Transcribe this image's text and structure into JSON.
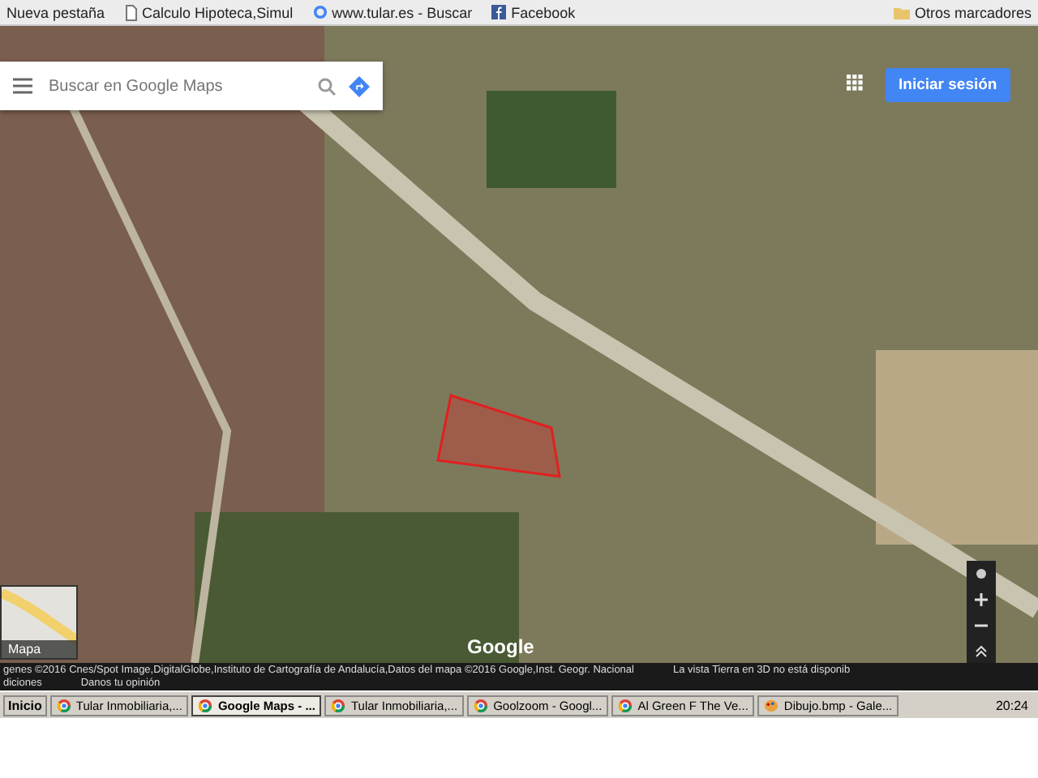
{
  "bookmarks": [
    {
      "label": "Nueva pestaña",
      "kind": "plain"
    },
    {
      "label": "Calculo Hipoteca,Simul",
      "kind": "page"
    },
    {
      "label": "www.tular.es - Buscar",
      "kind": "google"
    },
    {
      "label": "Facebook",
      "kind": "facebook"
    }
  ],
  "other_bookmarks": "Otros marcadores",
  "search": {
    "placeholder": "Buscar en Google Maps"
  },
  "sign_in": "Iniciar sesión",
  "layer_thumbnail": "Mapa",
  "map_logo": "Google",
  "attribution": [
    "genes ©2016 Cnes/Spot Image,DigitalGlobe,Instituto de Cartografía de Andalucía,Datos del mapa ©2016 Google,Inst. Geogr. Nacional",
    "La vista Tierra en 3D no está disponib"
  ],
  "footer_links": [
    "diciones",
    "Danos tu opinión"
  ],
  "taskbar": {
    "start": "Inicio",
    "tasks": [
      {
        "label": "Tular Inmobiliaria,...",
        "kind": "chrome",
        "selected": false
      },
      {
        "label": "Google Maps - ...",
        "kind": "chrome",
        "selected": true
      },
      {
        "label": "Tular Inmobiliaria,...",
        "kind": "chrome",
        "selected": false
      },
      {
        "label": "Goolzoom - Googl...",
        "kind": "chrome",
        "selected": false
      },
      {
        "label": "Al Green F The Ve...",
        "kind": "chrome",
        "selected": false
      },
      {
        "label": "Dibujo.bmp - Gale...",
        "kind": "paint",
        "selected": false
      }
    ],
    "clock": "20:24"
  }
}
